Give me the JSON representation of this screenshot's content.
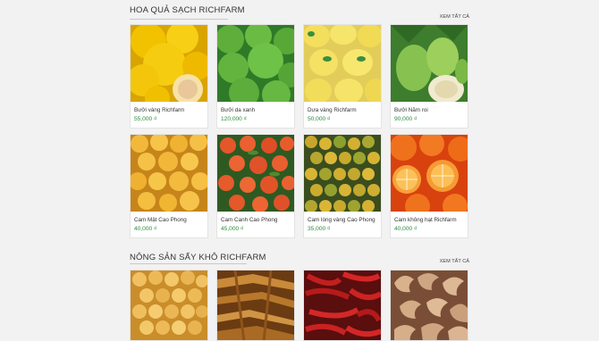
{
  "sections": [
    {
      "title": "HOA QUẢ SẠCH RICHFARM",
      "see_all": "XEM TẤT CẢ",
      "products": [
        {
          "name": "Bưởi vàng Richfarm",
          "price": "55,000 ₫",
          "image_icon": "yellow-pomelo-image"
        },
        {
          "name": "Bưởi da xanh",
          "price": "120,000 ₫",
          "image_icon": "green-pomelo-image"
        },
        {
          "name": "Dưa vàng Richfarm",
          "price": "50,000 ₫",
          "image_icon": "yellow-melon-image"
        },
        {
          "name": "Bưởi Năm roi",
          "price": "90,000 ₫",
          "image_icon": "nam-roi-pomelo-image"
        },
        {
          "name": "Cam Mật Cao Phong",
          "price": "40,000 ₫",
          "image_icon": "honey-orange-image"
        },
        {
          "name": "Cam Canh Cao Phong",
          "price": "45,000 ₫",
          "image_icon": "canh-orange-image"
        },
        {
          "name": "Cam lòng vàng Cao Phong",
          "price": "35,000 ₫",
          "image_icon": "small-orange-image"
        },
        {
          "name": "Cam không hạt Richfarm",
          "price": "40,000 ₫",
          "image_icon": "seedless-orange-image"
        }
      ]
    },
    {
      "title": "NÔNG SẢN SẤY KHÔ RICHFARM",
      "see_all": "XEM TẤT CẢ",
      "products": [
        {
          "image_icon": "dried-chickpea-image"
        },
        {
          "image_icon": "dried-bamboo-shoot-image"
        },
        {
          "image_icon": "dried-chili-image"
        },
        {
          "image_icon": "cashew-nut-image"
        }
      ]
    }
  ]
}
